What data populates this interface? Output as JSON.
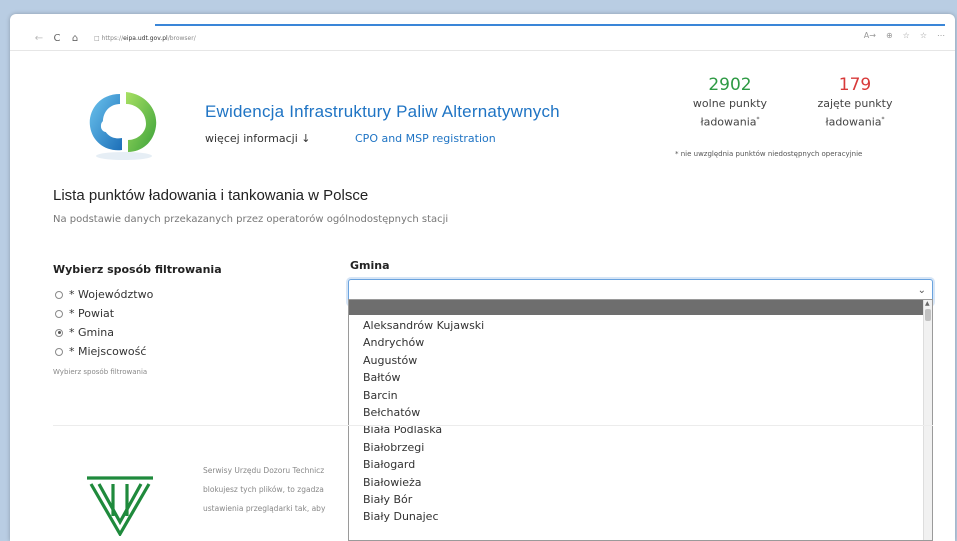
{
  "browser": {
    "url_prefix": "https://",
    "url_host": "eipa.udt.gov.pl",
    "url_path": "/browser/",
    "nav_back": "←",
    "nav_forward": "→",
    "nav_refresh": "C",
    "nav_home": "⌂",
    "lock": "🔒",
    "tb_read_aloud": "A→",
    "tb_zoom": "⊕",
    "tb_tracking": "☆",
    "tb_fav": "☆",
    "tb_more": "⋯"
  },
  "header": {
    "title": "Ewidencja Infrastruktury Paliw Alternatywnych",
    "more_info": "więcej informacji ↓",
    "cpo_link": "CPO and MSP registration"
  },
  "stats": {
    "free": {
      "value": "2902",
      "label_line1": "wolne punkty",
      "label_line2": "ładowania",
      "mark": "*",
      "color": "#2e9a44"
    },
    "busy": {
      "value": "179",
      "label_line1": "zajęte punkty",
      "label_line2": "ładowania",
      "mark": "*",
      "color": "#d83a3a"
    },
    "note": "* nie uwzględnia punktów niedostępnych operacyjnie"
  },
  "main": {
    "heading": "Lista punktów ładowania i tankowania w Polsce",
    "subheading": "Na podstawie danych przekazanych przez operatorów ogólnodostępnych stacji"
  },
  "filter": {
    "title": "Wybierz sposób filtrowania",
    "options": [
      {
        "label": "* Województwo",
        "checked": false
      },
      {
        "label": "* Powiat",
        "checked": false
      },
      {
        "label": "* Gmina",
        "checked": true
      },
      {
        "label": "* Miejscowość",
        "checked": false
      }
    ],
    "hint": "Wybierz sposób filtrowania"
  },
  "gmina": {
    "label": "Gmina",
    "selected_value": "",
    "chevron": "⌄",
    "options": [
      "Aleksandrów Kujawski",
      "Andrychów",
      "Augustów",
      "Bałtów",
      "Barcin",
      "Bełchatów",
      "Biała Podlaska",
      "Białobrzegi",
      "Białogard",
      "Białowieża",
      "Biały Bór",
      "Biały Dunajec"
    ]
  },
  "footer": {
    "line1": "Serwisy Urzędu Dozoru Technicz",
    "line2": "blokujesz tych plików, to zgadza",
    "line3": "ustawienia przeglądarki tak, aby"
  },
  "colors": {
    "brand_blue": "#1f74c4",
    "free_green": "#2e9a44",
    "busy_red": "#d83a3a",
    "udt_logo_green": "#1f8a3c"
  }
}
